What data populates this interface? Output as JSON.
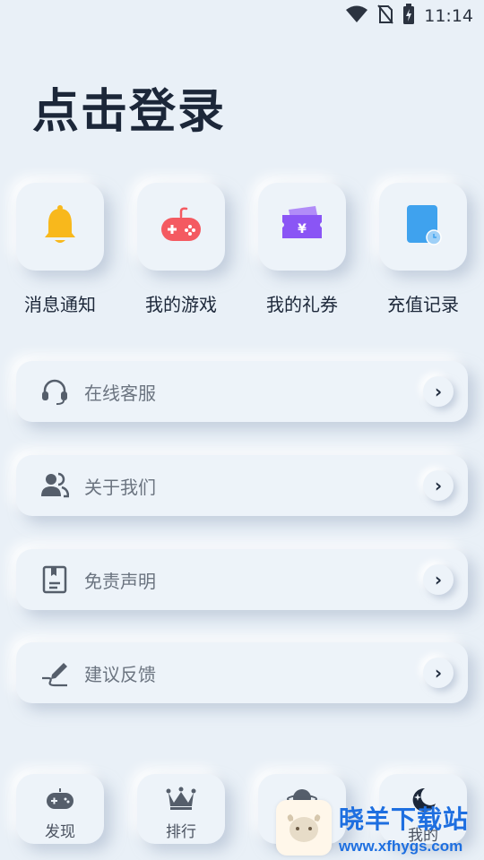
{
  "status_bar": {
    "time": "11:14",
    "icons": [
      "wifi-icon",
      "no-sim-icon",
      "battery-charging-icon"
    ]
  },
  "header": {
    "login_title": "点击登录"
  },
  "shortcuts": [
    {
      "label": "消息通知",
      "icon": "bell-icon",
      "color": "#f8b81c"
    },
    {
      "label": "我的游戏",
      "icon": "gamepad-icon",
      "color": "#f45a61"
    },
    {
      "label": "我的礼券",
      "icon": "coupon-icon",
      "color": "#8a55f5"
    },
    {
      "label": "充值记录",
      "icon": "recharge-record-icon",
      "color": "#3fa2ee"
    }
  ],
  "menu": [
    {
      "label": "在线客服",
      "icon": "headset-icon"
    },
    {
      "label": "关于我们",
      "icon": "users-icon"
    },
    {
      "label": "免责声明",
      "icon": "document-icon"
    },
    {
      "label": "建议反馈",
      "icon": "pen-icon"
    }
  ],
  "bottom_nav": [
    {
      "label": "发现",
      "icon": "gamepad-icon"
    },
    {
      "label": "排行",
      "icon": "crown-icon"
    },
    {
      "label": "",
      "icon": "planet-icon"
    },
    {
      "label": "我的",
      "icon": "moon-icon",
      "active": true
    }
  ],
  "watermark": {
    "cn": "晓羊下载站",
    "en": "www.xfhygs.com"
  },
  "colors": {
    "background": "#e9f0f7",
    "accent_yellow": "#f8b81c",
    "accent_red": "#f45a61",
    "accent_purple": "#8a55f5",
    "accent_blue": "#3fa2ee",
    "watermark_blue": "#1e6fe0"
  }
}
